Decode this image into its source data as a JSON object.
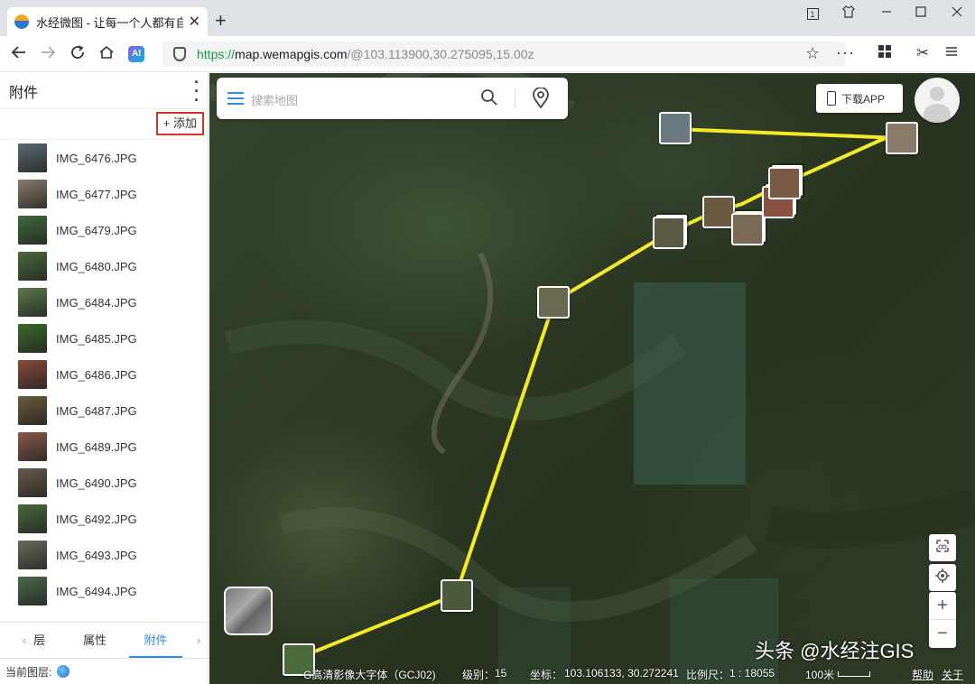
{
  "browser": {
    "tab_title": "水经微图 - 让每一个人都有自",
    "tab_close": "✕",
    "new_tab": "+",
    "url_proto": "https://",
    "url_host": "map.wemapgis.com",
    "url_path": "/@103.113900,30.275095,15.00z",
    "ai_label": "AI",
    "win_one": "1"
  },
  "sidebar": {
    "title": "附件",
    "add_label": "+ 添加",
    "files": [
      {
        "name": "IMG_6476.JPG",
        "color": "#5a6b74"
      },
      {
        "name": "IMG_6477.JPG",
        "color": "#8a7a6a"
      },
      {
        "name": "IMG_6479.JPG",
        "color": "#3f6a3a"
      },
      {
        "name": "IMG_6480.JPG",
        "color": "#4a6a3a"
      },
      {
        "name": "IMG_6484.JPG",
        "color": "#5a7a4a"
      },
      {
        "name": "IMG_6485.JPG",
        "color": "#3a6a2a"
      },
      {
        "name": "IMG_6486.JPG",
        "color": "#8a4a3a"
      },
      {
        "name": "IMG_6487.JPG",
        "color": "#6a5a3a"
      },
      {
        "name": "IMG_6489.JPG",
        "color": "#8a5a4a"
      },
      {
        "name": "IMG_6490.JPG",
        "color": "#6a5a4a"
      },
      {
        "name": "IMG_6492.JPG",
        "color": "#4a6a3a"
      },
      {
        "name": "IMG_6493.JPG",
        "color": "#6a6a5a"
      },
      {
        "name": "IMG_6494.JPG",
        "color": "#4a6a4a"
      }
    ],
    "tabs": [
      {
        "label": "层",
        "arrow": "‹"
      },
      {
        "label": "属性"
      },
      {
        "label": "附件",
        "arrow": "›"
      }
    ],
    "footer_label": "当前图层:"
  },
  "map": {
    "search_placeholder": "搜索地图",
    "download_label": "下载APP",
    "track_color": "#f5e92a",
    "status": {
      "layer": "G高清影像大字体（GCJ02)",
      "level_label": "级别：",
      "level": "15",
      "coord_label": "坐标：",
      "coord": "103.106133, 30.272241",
      "scale_label": "比例尺：",
      "scale": "1 : 18055",
      "scale_bar": "100米",
      "help": "帮助",
      "about": "关于"
    },
    "watermark": "头条 @水经注GIS"
  }
}
